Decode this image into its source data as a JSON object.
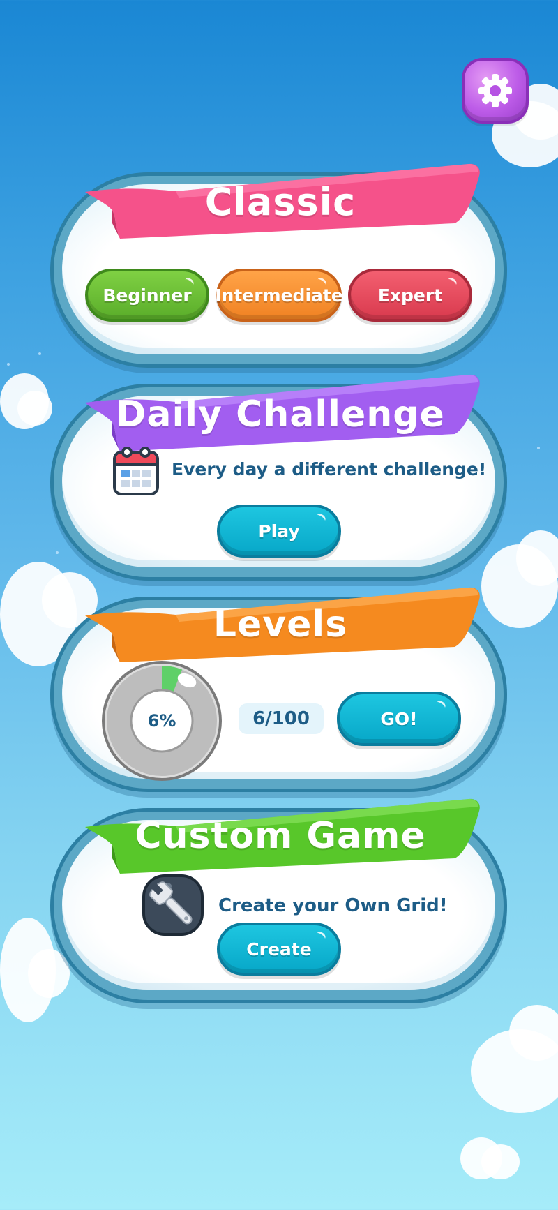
{
  "settings": {
    "icon": "gear-icon"
  },
  "classic": {
    "title": "Classic",
    "ribbon_color": "#f5528a",
    "buttons": [
      {
        "label": "Beginner",
        "color": "#5aad2a"
      },
      {
        "label": "Intermediate",
        "color": "#f08223"
      },
      {
        "label": "Expert",
        "color": "#d93a4e"
      }
    ]
  },
  "daily": {
    "title": "Daily Challenge",
    "ribbon_color": "#a25ef0",
    "icon": "calendar-icon",
    "description": "Every day a different challenge!",
    "play_label": "Play"
  },
  "levels": {
    "title": "Levels",
    "ribbon_color": "#f58a1f",
    "progress_text": "6%",
    "progress_value": 0.06,
    "count_text": "6/100",
    "go_label": "GO!"
  },
  "custom": {
    "title": "Custom Game",
    "ribbon_color": "#58c72a",
    "icon": "wrench-icon",
    "description": "Create your Own Grid!",
    "create_label": "Create"
  }
}
